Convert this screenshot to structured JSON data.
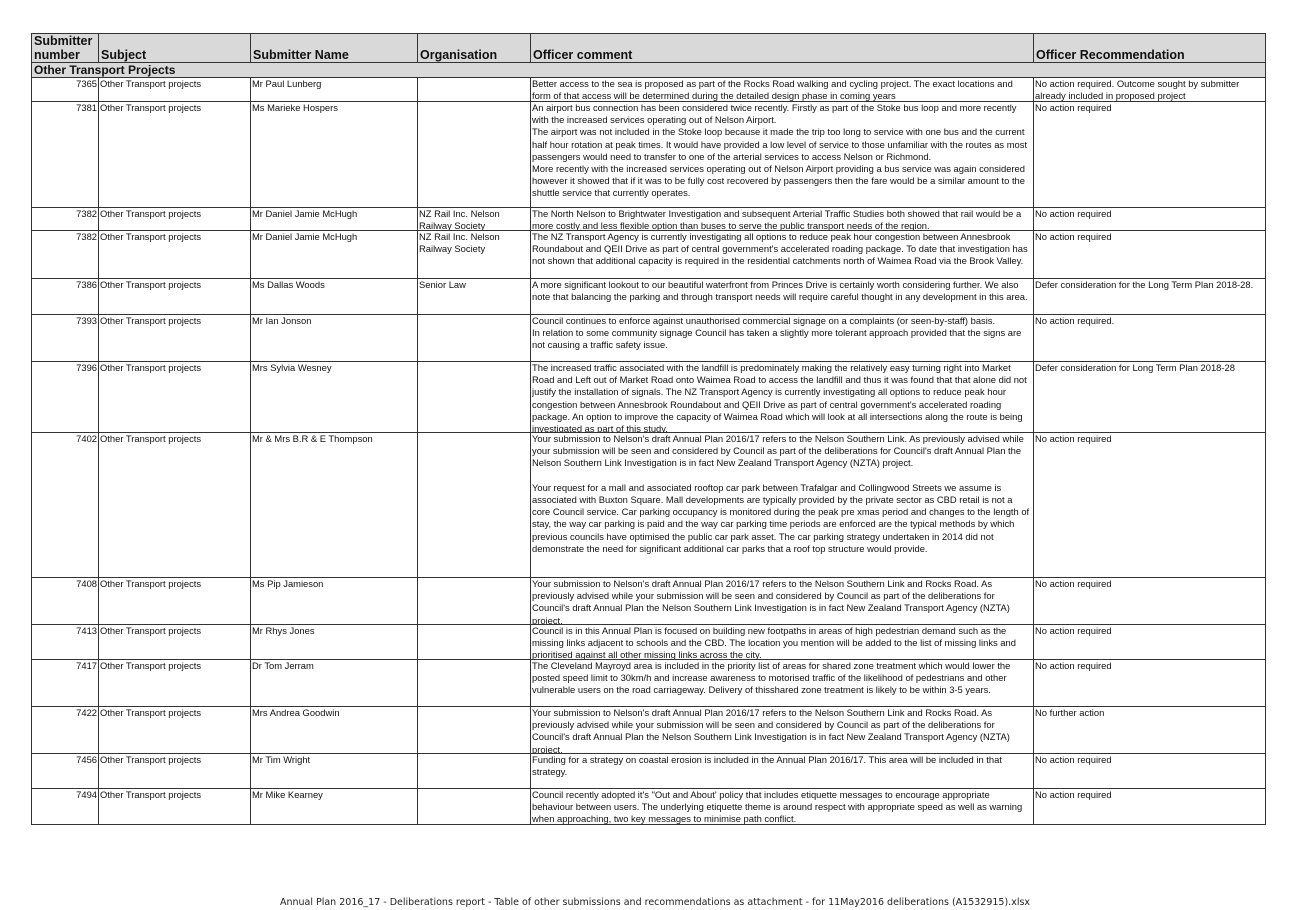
{
  "headers": {
    "number": "Submitter number",
    "subject": "Subject",
    "name": "Submitter Name",
    "organisation": "Organisation",
    "comment": "Officer comment",
    "recommendation": "Officer Recommendation"
  },
  "section_title": "Other Transport Projects",
  "rows": [
    {
      "number": "7365",
      "subject": "Other Transport projects",
      "name": "Mr Paul Lunberg",
      "organisation": "",
      "comment": "Better access to the sea is proposed as part of the Rocks Road walking and cycling project.  The exact locations and form of that access will be determined during the detailed design phase in coming years",
      "recommendation": "No action required.  Outcome sought by submitter already included in proposed project"
    },
    {
      "number": "7381",
      "subject": "Other Transport projects",
      "name": "Ms Marieke Hospers",
      "organisation": "",
      "comment": "An airport bus connection has been considered twice recently.  Firstly as part of the Stoke bus loop and more recently with the increased services operating out of Nelson Airport.\nThe airport was not included in the Stoke loop because it made the trip too long to service with one bus and the current half hour rotation at peak times.  It would have provided a low level of service to those unfamiliar with the routes as most passengers would need to transfer to one of the arterial services to access Nelson or Richmond.\nMore recently with the increased services operating out of Nelson Airport providing a bus service was again considered however it showed that if it was to be fully cost recovered by passengers then the fare would be a similar amount to the shuttle service that currently operates.",
      "recommendation": "No action required"
    },
    {
      "number": "7382",
      "subject": "Other Transport projects",
      "name": "Mr Daniel Jamie McHugh",
      "organisation": "NZ Rail Inc. Nelson Railway Society",
      "comment": "The North Nelson to Brightwater Investigation and subsequent Arterial Traffic Studies both showed that rail would be a more costly and less flexible option than buses to serve the public transport needs of the region.",
      "recommendation": "No action required"
    },
    {
      "number": "7382",
      "subject": "Other Transport projects",
      "name": "Mr Daniel Jamie McHugh",
      "organisation": "NZ Rail Inc. Nelson Railway Society",
      "comment": "The NZ Transport Agency is currently investigating all options to reduce peak hour congestion between Annesbrook Roundabout and QEII Drive as part of central government's accelerated roading package.  To date that investigation has not shown that additional capacity is required in the residential catchments north of Waimea Road via the Brook Valley.",
      "recommendation": "No action required"
    },
    {
      "number": "7386",
      "subject": "Other Transport projects",
      "name": "Ms Dallas Woods",
      "organisation": "Senior Law",
      "comment": "A more significant lookout to our beautiful waterfront from Princes Drive is certainly worth considering further.  We also note that balancing the parking and through transport needs will require careful thought in any development in this area.",
      "recommendation": "Defer consideration for the Long Term Plan 2018-28."
    },
    {
      "number": "7393",
      "subject": "Other Transport projects",
      "name": "Mr Ian Jonson",
      "organisation": "",
      "comment": "Council continues to enforce against unauthorised commercial signage on a complaints (or seen-by-staff) basis.\nIn relation to some community signage Council has taken a slightly more tolerant approach provided that the signs are not causing a traffic safety issue.",
      "recommendation": "No action required."
    },
    {
      "number": "7396",
      "subject": "Other Transport projects",
      "name": "Mrs Sylvia Wesney",
      "organisation": "",
      "comment": "The increased traffic associated with the landfill is predominately making the relatively easy turning right into Market Road and Left out of Market Road onto Waimea Road  to access the landfill and thus it was found that that alone did not justify the installation of signals.  The NZ Transport Agency is currently investigating all options to reduce peak hour congestion between Annesbrook Roundabout and QEII Drive as part of central government's accelerated roading package. An option to improve the capacity of Waimea Road which will look at all intersections along the route is being investigated as part of this study.",
      "recommendation": "Defer consideration for Long Term Plan 2018-28"
    },
    {
      "number": "7402",
      "subject": "Other Transport projects",
      "name": "Mr & Mrs B.R & E Thompson",
      "organisation": "",
      "comment": "Your submission to Nelson's draft Annual Plan 2016/17 refers to the Nelson Southern Link. As previously advised while your submission will be seen and considered by Council as part of the  deliberations for Council's draft Annual Plan the Nelson Southern Link Investigation is in fact New Zealand Transport Agency (NZTA) project.\n\nYour request for a mall and associated rooftop car park between Trafalgar and Collingwood Streets we assume is associated with Buxton Square.  Mall developments are typically provided by the private sector as CBD retail is not a core Council service.  Car parking occupancy is monitored during the peak pre xmas period and changes to the length of stay, the way car parking is paid and the way car parking time periods are enforced are the typical methods by which previous councils have optimised the public car park asset.  The car parking strategy undertaken in 2014 did not demonstrate the need for significant additional car parks that a roof top structure would provide.",
      "recommendation": "No action required"
    },
    {
      "number": "7408",
      "subject": "Other Transport projects",
      "name": "Ms Pip Jamieson",
      "organisation": "",
      "comment": "Your submission to Nelson's draft Annual Plan 2016/17 refers to the Nelson Southern Link and Rocks Road. As previously advised while your submission will be seen and considered by Council as part of the deliberations for Council's draft Annual Plan the Nelson Southern Link Investigation is in fact New Zealand Transport Agency (NZTA) project.",
      "recommendation": "No action required"
    },
    {
      "number": "7413",
      "subject": "Other Transport projects",
      "name": "Mr Rhys Jones",
      "organisation": "",
      "comment": "Council is in this Annual Plan is focused on building new footpaths in areas of high pedestrian demand such as the missing links adjacent to schools and the CBD.  The location you mention will be added to the list of missing links and prioritised against all other missing links across the city.",
      "recommendation": "No action required"
    },
    {
      "number": "7417",
      "subject": "Other Transport projects",
      "name": "Dr Tom Jerram",
      "organisation": "",
      "comment": "The Cleveland Mayroyd area is included in the priority list of areas for shared zone treatment which would lower the posted speed limit to 30km/h and increase awareness to motorised traffic of the likelihood of pedestrians and other vulnerable users on the road carriageway.  Delivery of thisshared zone treatment is likely to be within 3-5 years.",
      "recommendation": "No action required"
    },
    {
      "number": "7422",
      "subject": "Other Transport projects",
      "name": "Mrs Andrea Goodwin",
      "organisation": "",
      "comment": "Your submission to Nelson's draft Annual Plan 2016/17 refers to the Nelson Southern Link and Rocks Road. As previously advised while your submission will be seen and considered by Council as part of the deliberations for Council's draft Annual Plan the Nelson Southern Link Investigation is in fact New Zealand Transport Agency (NZTA) project.",
      "recommendation": "No further action"
    },
    {
      "number": "7456",
      "subject": "Other Transport projects",
      "name": "Mr Tim Wright",
      "organisation": "",
      "comment": "Funding for a strategy on coastal erosion is included in the Annual Plan 2016/17. This area will be included in that strategy.",
      "recommendation": "No action required"
    },
    {
      "number": "7494",
      "subject": "Other Transport projects",
      "name": "Mr Mike Kearney",
      "organisation": "",
      "comment": "Council recently adopted it's \"Out and About' policy that includes etiquette messages to encourage appropriate behaviour between users. The underlying etiquette theme is around respect with appropriate speed as well as warning when approaching, two key messages to minimise path conflict.",
      "recommendation": "No action required"
    }
  ],
  "footer": "Annual Plan 2016_17 - Deliberations report - Table of other submissions and recommendations as attachment - for 11May2016 deliberations (A1532915).xlsx"
}
